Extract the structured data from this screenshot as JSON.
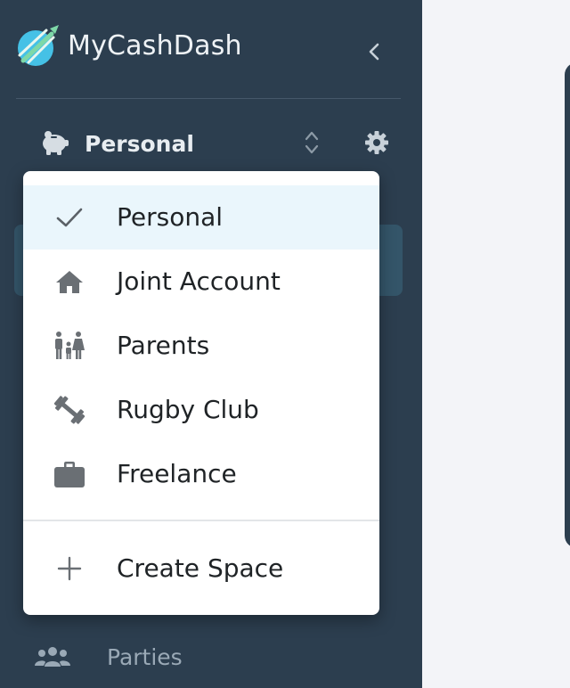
{
  "app": {
    "name": "MyCashDash"
  },
  "sidebar": {
    "current_space": "Personal",
    "nav_bottom": {
      "label": "Parties",
      "icon": "people-group-icon"
    }
  },
  "dropdown": {
    "items": [
      {
        "label": "Personal",
        "icon": "check-icon",
        "selected": true
      },
      {
        "label": "Joint Account",
        "icon": "house-icon",
        "selected": false
      },
      {
        "label": "Parents",
        "icon": "family-icon",
        "selected": false
      },
      {
        "label": "Rugby Club",
        "icon": "dumbbell-icon",
        "selected": false
      },
      {
        "label": "Freelance",
        "icon": "briefcase-icon",
        "selected": false
      }
    ],
    "create": {
      "label": "Create Space",
      "icon": "plus-icon"
    }
  },
  "colors": {
    "sidebar_bg": "#2c3e4f",
    "selected_bg": "#eaf6fc",
    "logo_teal": "#45c1e6",
    "logo_green": "#7ed8a8"
  }
}
